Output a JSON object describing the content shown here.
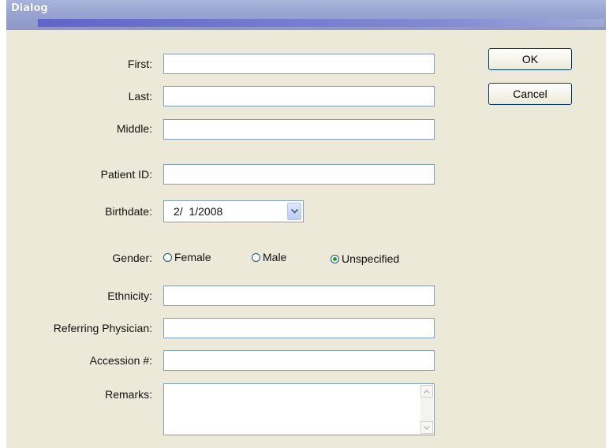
{
  "window": {
    "title": "Dialog"
  },
  "labels": {
    "first": "First:",
    "last": "Last:",
    "middle": "Middle:",
    "patient_id": "Patient ID:",
    "birthdate": "Birthdate:",
    "gender": "Gender:",
    "ethnicity": "Ethnicity:",
    "referring_physician": "Referring Physician:",
    "accession": "Accession #:",
    "remarks": "Remarks:"
  },
  "fields": {
    "first": "",
    "last": "",
    "middle": "",
    "patient_id": "",
    "birthdate": "2/  1/2008",
    "ethnicity": "",
    "referring_physician": "",
    "accession": "",
    "remarks": ""
  },
  "gender": {
    "options": [
      "Female",
      "Male",
      "Unspecified"
    ],
    "selected": "Unspecified"
  },
  "buttons": {
    "ok": "OK",
    "cancel": "Cancel"
  },
  "icons": {
    "dropdown": "chevron-down-icon",
    "scroll_up": "scroll-up-arrow-icon",
    "scroll_down": "scroll-down-arrow-icon"
  }
}
